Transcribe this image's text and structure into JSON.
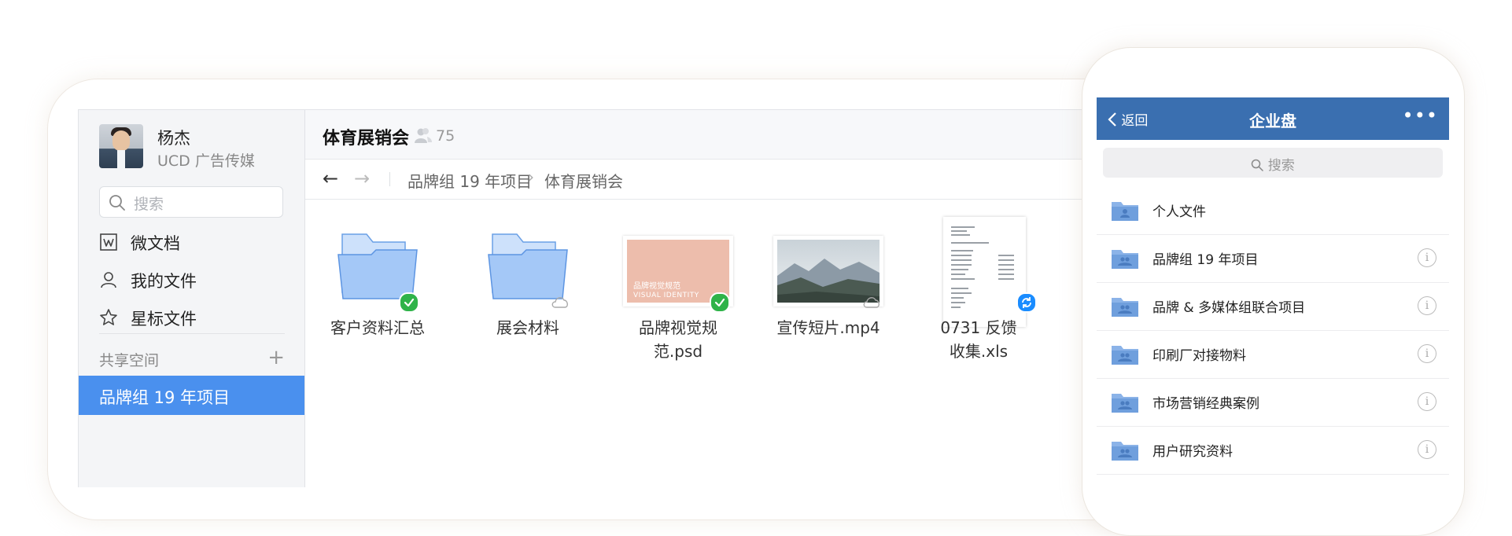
{
  "sidebar": {
    "user_name": "杨杰",
    "user_org": "UCD 广告传媒",
    "search_placeholder": "搜索",
    "nav": [
      {
        "label": "微文档",
        "icon": "doc-w-icon"
      },
      {
        "label": "我的文件",
        "icon": "person-icon"
      },
      {
        "label": "星标文件",
        "icon": "star-icon"
      }
    ],
    "shared_label": "共享空间",
    "shared_add": "+",
    "active_item": "品牌组 19 年项目"
  },
  "main": {
    "title": "体育展销会",
    "member_count": "75",
    "back_arrow": "←",
    "forward_arrow": "→",
    "breadcrumb": [
      "品牌组 19 年项目",
      "体育展销会"
    ],
    "breadcrumb_sep": "›",
    "files": [
      {
        "name": "客户资料汇总",
        "type": "folder",
        "status": "synced"
      },
      {
        "name": "展会材料",
        "type": "folder",
        "status": "cloud"
      },
      {
        "name": "品牌视觉规范.psd",
        "type": "psd",
        "status": "synced",
        "thumb_title": "品牌视觉规范",
        "thumb_subtitle": "VISUAL IDENTITY"
      },
      {
        "name": "宣传短片.mp4",
        "type": "video",
        "status": "cloud"
      },
      {
        "name": "0731 反馈收集.xls",
        "type": "xls",
        "status": "syncing"
      }
    ]
  },
  "mobile": {
    "back_label": "返回",
    "title": "企业盘",
    "more": "•••",
    "search_placeholder": "搜索",
    "info_glyph": "i",
    "items": [
      {
        "label": "个人文件",
        "icon": "personal-folder-icon",
        "info": false
      },
      {
        "label": "品牌组 19 年项目",
        "icon": "shared-folder-icon",
        "info": true
      },
      {
        "label": "品牌 & 多媒体组联合项目",
        "icon": "shared-folder-icon",
        "info": true
      },
      {
        "label": "印刷厂对接物料",
        "icon": "shared-folder-icon",
        "info": true
      },
      {
        "label": "市场营销经典案例",
        "icon": "shared-folder-icon",
        "info": true
      },
      {
        "label": "用户研究资料",
        "icon": "shared-folder-icon",
        "info": true
      }
    ]
  },
  "colors": {
    "accent": "#4a90ee",
    "mobile_header": "#3a6fb0",
    "ok_badge": "#2fb349",
    "sync_badge": "#1a8cff"
  }
}
